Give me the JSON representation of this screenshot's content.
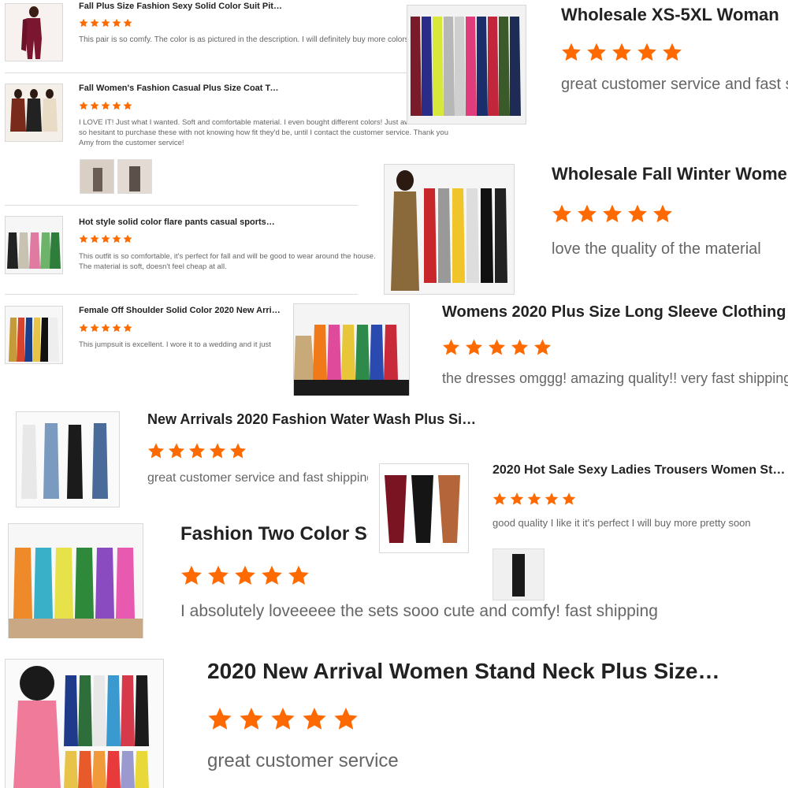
{
  "accent_color": "#ff6a00",
  "reviews": [
    {
      "title": "Fall Plus Size Fashion Sexy Solid Color Suit Pit …",
      "stars": 5,
      "text": "This pair is so comfy. The color is as pictured in the description. I will definitely buy more colors"
    },
    {
      "title": "Fall Women's Fashion Casual Plus Size Coat Tu…",
      "stars": 5,
      "text": "I LOVE IT! Just what I wanted. Soft and comfortable material. I even bought different colors! Just awesome! I was so hesitant to purchase these with not knowing how fit they'd be, until I contact the customer service. Thank you Amy from the customer service!"
    },
    {
      "title": "Hot style solid color flare pants casual sportsw…",
      "stars": 5,
      "text": "This outfit is so comfortable, it's perfect for fall and will be good to wear around the house. The material is soft, doesn't feel cheap at all."
    },
    {
      "title": "Female Off Shoulder Solid Color 2020 New Arri…",
      "stars": 5,
      "text": "This jumpsuit is excellent. I wore it to a wedding and it just"
    },
    {
      "title": "Wholesale XS-5XL Woman",
      "stars": 5,
      "text": "great customer service and fast shipping"
    },
    {
      "title": "Wholesale Fall Winter Women",
      "stars": 5,
      "text": "love the quality of the material"
    },
    {
      "title": "Womens 2020 Plus Size Long Sleeve Clothing",
      "stars": 5,
      "text": "the dresses omggg! amazing quality!! very fast shipping"
    },
    {
      "title": "New Arrivals 2020 Fashion Water Wash Plus Si…",
      "stars": 5,
      "text": "great customer service and fast shipping"
    },
    {
      "title": "2020 Hot Sale Sexy Ladies Trousers Women St…",
      "stars": 5,
      "text": "good quality I like it it's perfect I will buy more pretty soon"
    },
    {
      "title": "Fashion Two Color Sets",
      "stars": 5,
      "text": "I absolutely loveeeee the sets sooo cute and comfy! fast shipping"
    },
    {
      "title": "2020 New Arrival Women Stand Neck Plus Size…",
      "stars": 5,
      "text": "great customer service"
    }
  ]
}
